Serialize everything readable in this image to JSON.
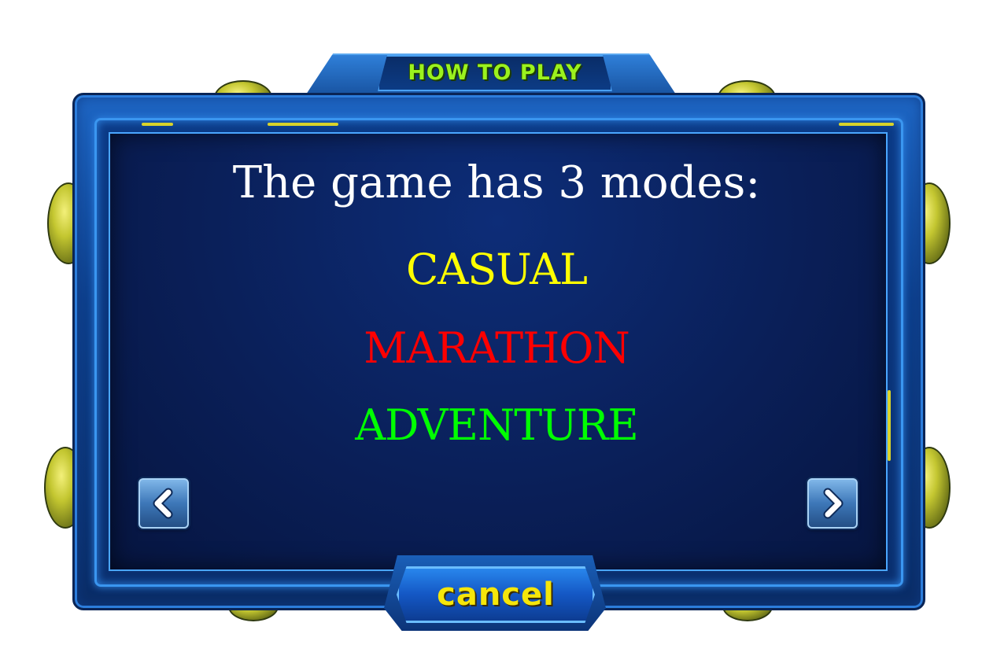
{
  "dialog": {
    "title": "HOW TO PLAY",
    "heading": "The game has 3 modes:",
    "modes": [
      {
        "label": "CASUAL",
        "color": "#ffff00"
      },
      {
        "label": "MARATHON",
        "color": "#ff0000"
      },
      {
        "label": "ADVENTURE",
        "color": "#00ff00"
      }
    ],
    "cancel_label": "cancel"
  },
  "icons": {
    "prev": "chevron-left-icon",
    "next": "chevron-right-icon"
  },
  "colors": {
    "title_text": "#9bf21e",
    "cancel_text": "#f5e60a",
    "screen_bg": "#0a1f58"
  }
}
